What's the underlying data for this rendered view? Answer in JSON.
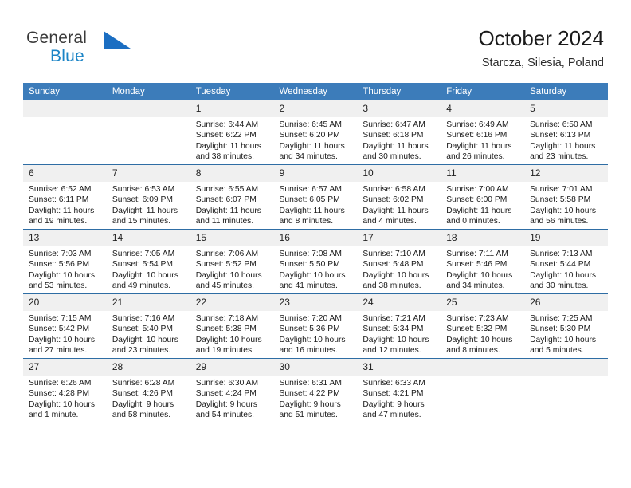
{
  "brand": {
    "line1": "General",
    "line2": "Blue",
    "mark": "triangle-logo"
  },
  "header": {
    "title": "October 2024",
    "subtitle": "Starcza, Silesia, Poland"
  },
  "colors": {
    "header_blue": "#3c7cba",
    "row_rule_blue": "#2e6da4",
    "daynum_band": "#f0f0f0",
    "brand_blue": "#1b84c6"
  },
  "calendar": {
    "weekday_headers": [
      "Sunday",
      "Monday",
      "Tuesday",
      "Wednesday",
      "Thursday",
      "Friday",
      "Saturday"
    ],
    "labels": {
      "sunrise": "Sunrise:",
      "sunset": "Sunset:",
      "daylight": "Daylight:"
    },
    "weeks": [
      [
        {
          "day": "",
          "blank": true,
          "sunrise": "",
          "sunset": "",
          "daylight_line1": "",
          "daylight_line2": ""
        },
        {
          "day": "",
          "blank": true,
          "sunrise": "",
          "sunset": "",
          "daylight_line1": "",
          "daylight_line2": ""
        },
        {
          "day": "1",
          "blank": false,
          "sunrise": "Sunrise: 6:44 AM",
          "sunset": "Sunset: 6:22 PM",
          "daylight_line1": "Daylight: 11 hours",
          "daylight_line2": "and 38 minutes."
        },
        {
          "day": "2",
          "blank": false,
          "sunrise": "Sunrise: 6:45 AM",
          "sunset": "Sunset: 6:20 PM",
          "daylight_line1": "Daylight: 11 hours",
          "daylight_line2": "and 34 minutes."
        },
        {
          "day": "3",
          "blank": false,
          "sunrise": "Sunrise: 6:47 AM",
          "sunset": "Sunset: 6:18 PM",
          "daylight_line1": "Daylight: 11 hours",
          "daylight_line2": "and 30 minutes."
        },
        {
          "day": "4",
          "blank": false,
          "sunrise": "Sunrise: 6:49 AM",
          "sunset": "Sunset: 6:16 PM",
          "daylight_line1": "Daylight: 11 hours",
          "daylight_line2": "and 26 minutes."
        },
        {
          "day": "5",
          "blank": false,
          "sunrise": "Sunrise: 6:50 AM",
          "sunset": "Sunset: 6:13 PM",
          "daylight_line1": "Daylight: 11 hours",
          "daylight_line2": "and 23 minutes."
        }
      ],
      [
        {
          "day": "6",
          "blank": false,
          "sunrise": "Sunrise: 6:52 AM",
          "sunset": "Sunset: 6:11 PM",
          "daylight_line1": "Daylight: 11 hours",
          "daylight_line2": "and 19 minutes."
        },
        {
          "day": "7",
          "blank": false,
          "sunrise": "Sunrise: 6:53 AM",
          "sunset": "Sunset: 6:09 PM",
          "daylight_line1": "Daylight: 11 hours",
          "daylight_line2": "and 15 minutes."
        },
        {
          "day": "8",
          "blank": false,
          "sunrise": "Sunrise: 6:55 AM",
          "sunset": "Sunset: 6:07 PM",
          "daylight_line1": "Daylight: 11 hours",
          "daylight_line2": "and 11 minutes."
        },
        {
          "day": "9",
          "blank": false,
          "sunrise": "Sunrise: 6:57 AM",
          "sunset": "Sunset: 6:05 PM",
          "daylight_line1": "Daylight: 11 hours",
          "daylight_line2": "and 8 minutes."
        },
        {
          "day": "10",
          "blank": false,
          "sunrise": "Sunrise: 6:58 AM",
          "sunset": "Sunset: 6:02 PM",
          "daylight_line1": "Daylight: 11 hours",
          "daylight_line2": "and 4 minutes."
        },
        {
          "day": "11",
          "blank": false,
          "sunrise": "Sunrise: 7:00 AM",
          "sunset": "Sunset: 6:00 PM",
          "daylight_line1": "Daylight: 11 hours",
          "daylight_line2": "and 0 minutes."
        },
        {
          "day": "12",
          "blank": false,
          "sunrise": "Sunrise: 7:01 AM",
          "sunset": "Sunset: 5:58 PM",
          "daylight_line1": "Daylight: 10 hours",
          "daylight_line2": "and 56 minutes."
        }
      ],
      [
        {
          "day": "13",
          "blank": false,
          "sunrise": "Sunrise: 7:03 AM",
          "sunset": "Sunset: 5:56 PM",
          "daylight_line1": "Daylight: 10 hours",
          "daylight_line2": "and 53 minutes."
        },
        {
          "day": "14",
          "blank": false,
          "sunrise": "Sunrise: 7:05 AM",
          "sunset": "Sunset: 5:54 PM",
          "daylight_line1": "Daylight: 10 hours",
          "daylight_line2": "and 49 minutes."
        },
        {
          "day": "15",
          "blank": false,
          "sunrise": "Sunrise: 7:06 AM",
          "sunset": "Sunset: 5:52 PM",
          "daylight_line1": "Daylight: 10 hours",
          "daylight_line2": "and 45 minutes."
        },
        {
          "day": "16",
          "blank": false,
          "sunrise": "Sunrise: 7:08 AM",
          "sunset": "Sunset: 5:50 PM",
          "daylight_line1": "Daylight: 10 hours",
          "daylight_line2": "and 41 minutes."
        },
        {
          "day": "17",
          "blank": false,
          "sunrise": "Sunrise: 7:10 AM",
          "sunset": "Sunset: 5:48 PM",
          "daylight_line1": "Daylight: 10 hours",
          "daylight_line2": "and 38 minutes."
        },
        {
          "day": "18",
          "blank": false,
          "sunrise": "Sunrise: 7:11 AM",
          "sunset": "Sunset: 5:46 PM",
          "daylight_line1": "Daylight: 10 hours",
          "daylight_line2": "and 34 minutes."
        },
        {
          "day": "19",
          "blank": false,
          "sunrise": "Sunrise: 7:13 AM",
          "sunset": "Sunset: 5:44 PM",
          "daylight_line1": "Daylight: 10 hours",
          "daylight_line2": "and 30 minutes."
        }
      ],
      [
        {
          "day": "20",
          "blank": false,
          "sunrise": "Sunrise: 7:15 AM",
          "sunset": "Sunset: 5:42 PM",
          "daylight_line1": "Daylight: 10 hours",
          "daylight_line2": "and 27 minutes."
        },
        {
          "day": "21",
          "blank": false,
          "sunrise": "Sunrise: 7:16 AM",
          "sunset": "Sunset: 5:40 PM",
          "daylight_line1": "Daylight: 10 hours",
          "daylight_line2": "and 23 minutes."
        },
        {
          "day": "22",
          "blank": false,
          "sunrise": "Sunrise: 7:18 AM",
          "sunset": "Sunset: 5:38 PM",
          "daylight_line1": "Daylight: 10 hours",
          "daylight_line2": "and 19 minutes."
        },
        {
          "day": "23",
          "blank": false,
          "sunrise": "Sunrise: 7:20 AM",
          "sunset": "Sunset: 5:36 PM",
          "daylight_line1": "Daylight: 10 hours",
          "daylight_line2": "and 16 minutes."
        },
        {
          "day": "24",
          "blank": false,
          "sunrise": "Sunrise: 7:21 AM",
          "sunset": "Sunset: 5:34 PM",
          "daylight_line1": "Daylight: 10 hours",
          "daylight_line2": "and 12 minutes."
        },
        {
          "day": "25",
          "blank": false,
          "sunrise": "Sunrise: 7:23 AM",
          "sunset": "Sunset: 5:32 PM",
          "daylight_line1": "Daylight: 10 hours",
          "daylight_line2": "and 8 minutes."
        },
        {
          "day": "26",
          "blank": false,
          "sunrise": "Sunrise: 7:25 AM",
          "sunset": "Sunset: 5:30 PM",
          "daylight_line1": "Daylight: 10 hours",
          "daylight_line2": "and 5 minutes."
        }
      ],
      [
        {
          "day": "27",
          "blank": false,
          "sunrise": "Sunrise: 6:26 AM",
          "sunset": "Sunset: 4:28 PM",
          "daylight_line1": "Daylight: 10 hours",
          "daylight_line2": "and 1 minute."
        },
        {
          "day": "28",
          "blank": false,
          "sunrise": "Sunrise: 6:28 AM",
          "sunset": "Sunset: 4:26 PM",
          "daylight_line1": "Daylight: 9 hours",
          "daylight_line2": "and 58 minutes."
        },
        {
          "day": "29",
          "blank": false,
          "sunrise": "Sunrise: 6:30 AM",
          "sunset": "Sunset: 4:24 PM",
          "daylight_line1": "Daylight: 9 hours",
          "daylight_line2": "and 54 minutes."
        },
        {
          "day": "30",
          "blank": false,
          "sunrise": "Sunrise: 6:31 AM",
          "sunset": "Sunset: 4:22 PM",
          "daylight_line1": "Daylight: 9 hours",
          "daylight_line2": "and 51 minutes."
        },
        {
          "day": "31",
          "blank": false,
          "sunrise": "Sunrise: 6:33 AM",
          "sunset": "Sunset: 4:21 PM",
          "daylight_line1": "Daylight: 9 hours",
          "daylight_line2": "and 47 minutes."
        },
        {
          "day": "",
          "blank": true,
          "sunrise": "",
          "sunset": "",
          "daylight_line1": "",
          "daylight_line2": ""
        },
        {
          "day": "",
          "blank": true,
          "sunrise": "",
          "sunset": "",
          "daylight_line1": "",
          "daylight_line2": ""
        }
      ]
    ]
  }
}
